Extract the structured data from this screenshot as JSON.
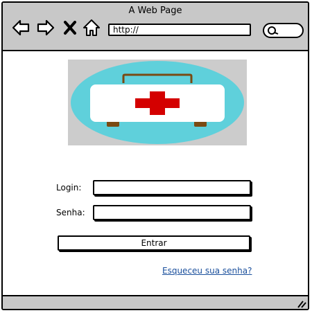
{
  "window": {
    "title": "A Web Page"
  },
  "toolbar": {
    "back_icon": "arrow-left-icon",
    "forward_icon": "arrow-right-icon",
    "close_icon": "x-icon",
    "home_icon": "home-icon",
    "url": "http://",
    "search_icon": "search-pill"
  },
  "logo": {
    "icon": "first-aid-kit-icon",
    "colors": {
      "background": "#cccccc",
      "ellipse": "#5fd0db",
      "cross": "#d40000",
      "handle": "#7a4a12"
    }
  },
  "form": {
    "login_label": "Login:",
    "login_value": "",
    "password_label": "Senha:",
    "password_value": "",
    "submit_label": "Entrar",
    "forgot_link": "Esqueceu sua senha?"
  },
  "colors": {
    "chrome": "#c8c8c8",
    "link": "#1a4f9c"
  }
}
